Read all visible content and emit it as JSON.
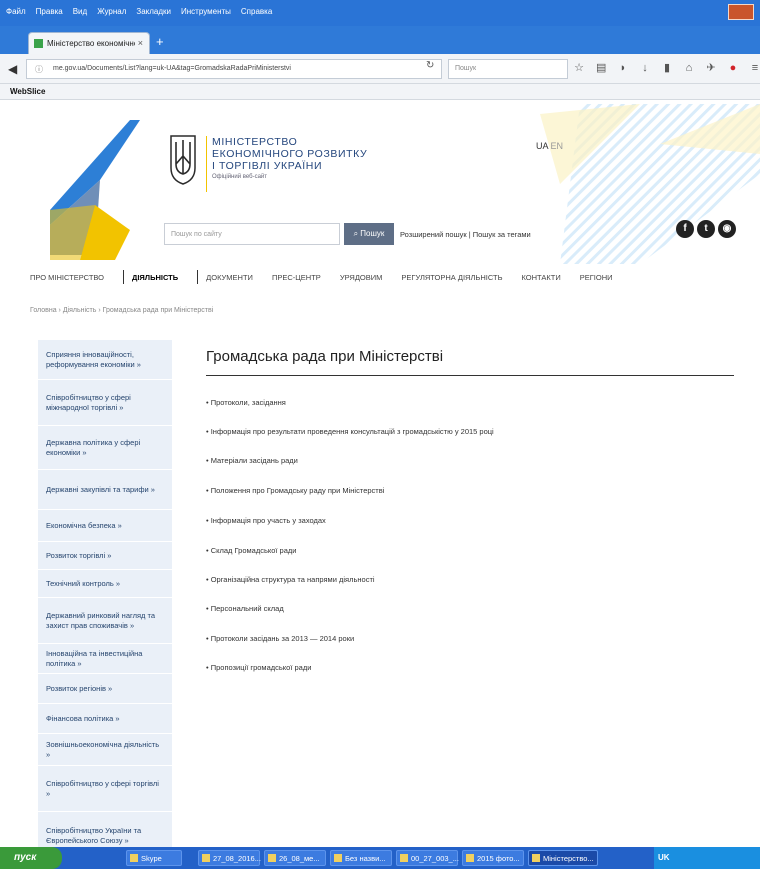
{
  "browser": {
    "menu": [
      "Файл",
      "Правка",
      "Вид",
      "Журнал",
      "Закладки",
      "Инструменты",
      "Справка"
    ],
    "tab_title": "Міністерство економічного",
    "tab_close": "×",
    "tab_new": "+",
    "url": "me.gov.ua/Documents/List?lang=uk-UA&tag=GromadskaRadaPriMinisterstvi",
    "search_placeholder": "Пошук",
    "bookmark": "WebSlice"
  },
  "header": {
    "ministry_lines": [
      "МІНІСТЕРСТВО",
      "ЕКОНОМІЧНОГО РОЗВИТКУ",
      "І ТОРГІВЛІ УКРАЇНИ"
    ],
    "ministry_sub": "Офіційний веб-сайт",
    "lang_ua": "UA",
    "lang_en": "EN",
    "search_placeholder": "Пошук по сайту",
    "search_button": "Пошук",
    "links": "Розширений пошук  |  Пошук за тегами"
  },
  "nav": {
    "items": [
      "ПРО МІНІСТЕРСТВО",
      "ДІЯЛЬНІСТЬ",
      "ДОКУМЕНТИ",
      "ПРЕС-ЦЕНТР",
      "УРЯДОВИМ",
      "РЕГУЛЯТОРНА ДІЯЛЬНІСТЬ",
      "КОНТАКТИ",
      "РЕГІОНИ"
    ]
  },
  "breadcrumb": "Головна › Діяльність › Громадська рада при Міністерстві",
  "sidebar": {
    "items": [
      "Сприяння інноваційності, реформування економіки »",
      "Співробітництво у сфері міжнародної торгівлі »",
      "Державна політика у сфері економіки »",
      "Державні закупівлі та тарифи »",
      "Економічна безпека »",
      "Розвиток торгівлі »",
      "Технічний контроль »",
      "Державний ринковий нагляд та захист прав споживачів »",
      "Інноваційна та інвестиційна політика »",
      "Розвиток регіонів »",
      "Фінансова політика »",
      "Зовнішньоекономічна діяльність »",
      "Співробітництво у сфері торгівлі »",
      "Співробітництво України та Європейського Союзу »"
    ]
  },
  "content": {
    "title": "Громадська рада при Міністерстві",
    "links": [
      "Протоколи, засідання",
      "Інформація про результати проведення консультацій з громадськістю у 2015 році",
      "Матеріали засідань ради",
      "Положення про Громадську раду при Міністерстві",
      "Інформація про участь у заходах",
      "Склад Громадської ради",
      "Організаційна структура та напрями діяльності",
      "Персональний склад",
      "Протоколи засідань за 2013 — 2014 роки",
      "Пропозиції громадської ради"
    ]
  },
  "taskbar": {
    "start": "пуск",
    "buttons": [
      "Skype",
      "27_08_2016...",
      "26_08_ме...",
      "Без назви...",
      "00_27_003_...",
      "2015 фото...",
      "Міністерство..."
    ],
    "tray_lang": "UK"
  },
  "colors": {
    "header_blue": "#2a74d6",
    "ministry_text": "#24467d",
    "accent_yellow": "#f2c300",
    "sidebar_bg": "#eaf0f8"
  }
}
